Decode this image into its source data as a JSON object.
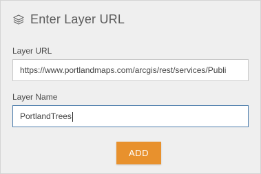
{
  "header": {
    "title": "Enter Layer URL",
    "icon": "layers-icon"
  },
  "form": {
    "url_label": "Layer URL",
    "url_value": "https://www.portlandmaps.com/arcgis/rest/services/Publi",
    "name_label": "Layer Name",
    "name_value": "PortlandTrees",
    "add_button_label": "ADD"
  },
  "colors": {
    "panel_background": "#efefef",
    "accent_button": "#e8912d",
    "focused_border": "#4c7cab"
  }
}
